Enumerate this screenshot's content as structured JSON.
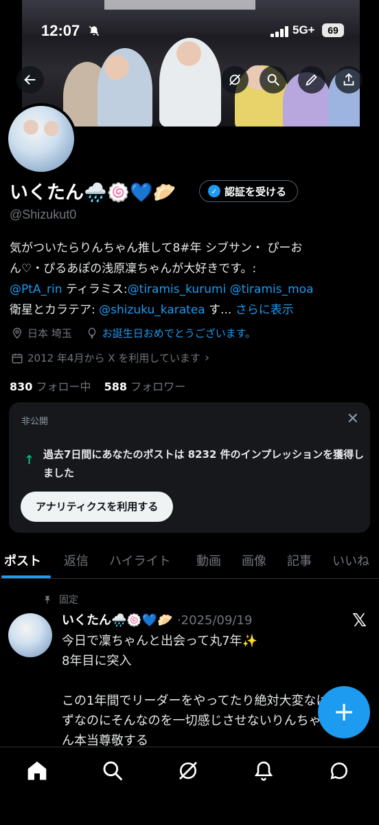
{
  "status_bar": {
    "time": "12:07",
    "network": "5G+",
    "battery": "69"
  },
  "profile": {
    "display_name": "いくたん🌧️🍥💙🥟",
    "verify_button": "認証を受ける",
    "handle": "@Shizukut0",
    "bio": {
      "line1": "気がついたらりんちゃん推して8#年 シブサン・ ぴーお",
      "line2": "ん♡・ぴるあぽの浅原凜ちゃんが大好きです。:",
      "line3_link1": "@PtA_rin",
      "line3_mid": " ティラミス:",
      "line3_link2": "@tiramis_kurumi",
      "line3_space": " ",
      "line3_link3": "@tiramis_moa",
      "line4_pre": "衛星とカラテア: ",
      "line4_link": "@shizuku_karatea",
      "line4_mid": " す... ",
      "line4_more": "さらに表示"
    },
    "location": "日本 埼玉",
    "birthday": "お誕生日おめでとうございます。",
    "joined": "2012 年4月から X を利用しています",
    "following_count": "830",
    "following_label": " フォロー中",
    "followers_count": "588",
    "followers_label": " フォロワー"
  },
  "private_card": {
    "label": "非公開",
    "message": "過去7日間にあなたのポストは 8232 件のインプレッションを獲得しました",
    "button": "アナリティクスを利用する"
  },
  "tabs": [
    "ポスト",
    "返信",
    "ハイライト",
    "動画",
    "画像",
    "記事",
    "いいね"
  ],
  "pinned_post": {
    "pinned_label": "固定",
    "author": "いくたん🌧️🍥💙🥟",
    "date": "·2025/09/19",
    "text": "今日で凜ちゃんと出会って丸7年✨\n8年目に突入\n\nこの1年間でリーダーをやってたり絶対大変なは\nずなのにそんなのを一切感じさせないりんちゃ\nん本当尊敬する"
  },
  "colors": {
    "accent": "#1d9bf0",
    "background": "#000000",
    "muted": "#71767b",
    "card": "#16181c"
  }
}
